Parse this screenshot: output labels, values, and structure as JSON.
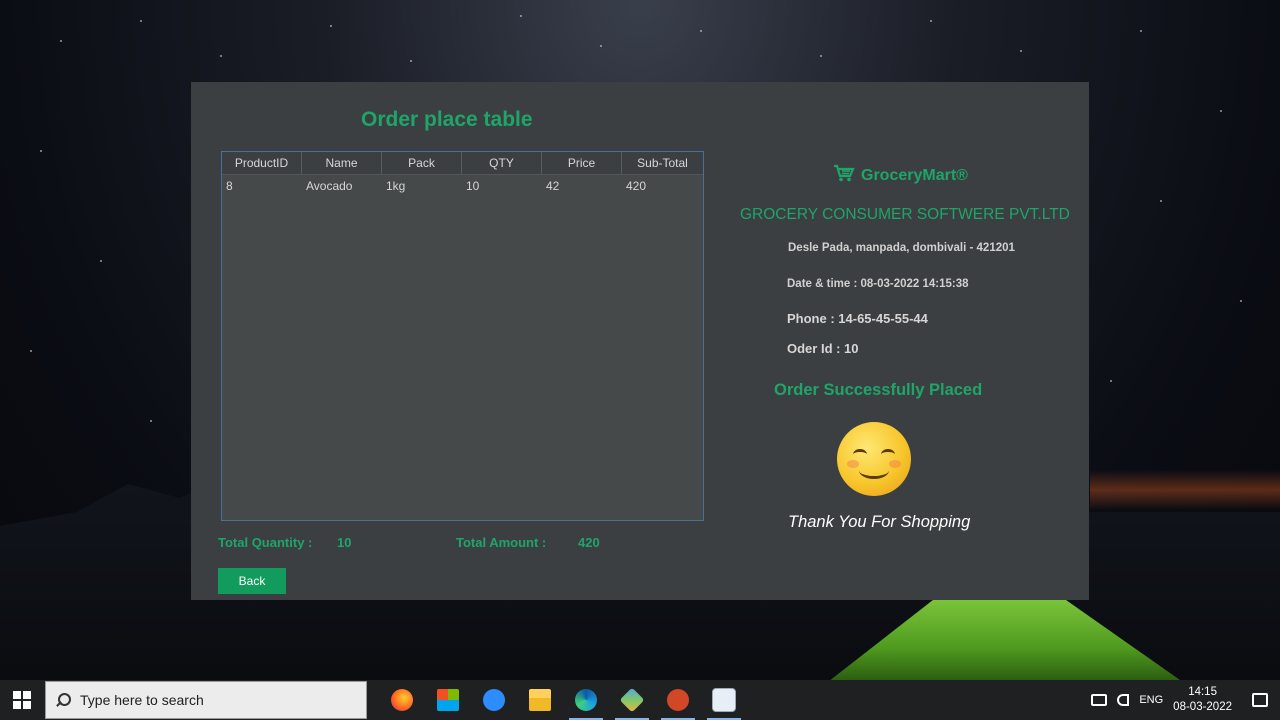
{
  "window": {
    "table_title": "Order place table",
    "columns": [
      "ProductID",
      "Name",
      "Pack",
      "QTY",
      "Price",
      "Sub-Total"
    ],
    "rows": [
      [
        "8",
        "Avocado",
        "1kg",
        "10",
        "42",
        "420"
      ]
    ],
    "total_quantity_label": "Total Quantity  :",
    "total_quantity_value": "10",
    "total_amount_label": "Total Amount   :",
    "total_amount_value": "420",
    "back_label": "Back",
    "brand_name": "GroceryMart®",
    "brand_icon": "cart-icon",
    "company": "GROCERY CONSUMER SOFTWERE PVT.LTD",
    "address": "Desle Pada, manpada, dombivali - 421201",
    "datetime": "Date & time :  08-03-2022 14:15:38",
    "phone": "Phone : 14-65-45-55-44",
    "order_id": "Oder  Id : 10",
    "success": "Order Successfully Placed",
    "thanks": "Thank You For Shopping",
    "accent_color": "#1ea56a"
  },
  "taskbar": {
    "search_placeholder": "Type here to search",
    "apps": [
      "firefox-icon",
      "store-icon",
      "zoom-icon",
      "file-explorer-icon",
      "edge-icon",
      "virtualbox-icon",
      "powerpoint-icon",
      "java-icon"
    ],
    "language": "ENG",
    "time": "14:15",
    "date": "08-03-2022"
  }
}
